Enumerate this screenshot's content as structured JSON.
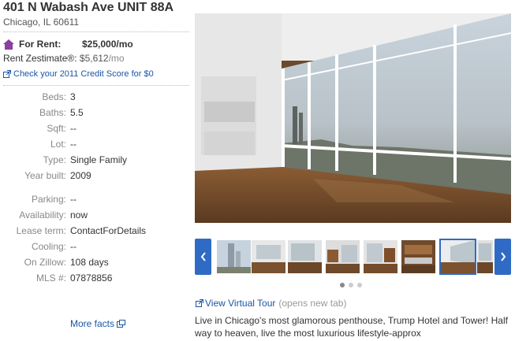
{
  "listing": {
    "address": "401 N Wabash Ave UNIT 88A",
    "city_state_zip": "Chicago, IL 60611"
  },
  "rent": {
    "label": "For Rent:",
    "price": "$25,000/mo",
    "zestimate_label": "Rent Zestimate®:",
    "zestimate_value": "$5,612",
    "zestimate_suffix": "/mo",
    "credit_link": "Check your 2011 Credit Score for $0"
  },
  "facts": [
    {
      "key": "Beds:",
      "value": "3"
    },
    {
      "key": "Baths:",
      "value": "5.5"
    },
    {
      "key": "Sqft:",
      "value": "--"
    },
    {
      "key": "Lot:",
      "value": "--"
    },
    {
      "key": "Type:",
      "value": "Single Family"
    },
    {
      "key": "Year built:",
      "value": "2009"
    },
    {
      "key": "Parking:",
      "value": "--"
    },
    {
      "key": "Availability:",
      "value": "now"
    },
    {
      "key": "Lease term:",
      "value": "ContactForDetails"
    },
    {
      "key": "Cooling:",
      "value": "--"
    },
    {
      "key": "On Zillow:",
      "value": "108 days"
    },
    {
      "key": "MLS #:",
      "value": "07878856"
    }
  ],
  "more_facts_label": "More facts",
  "virtual_tour": {
    "link": "View Virtual Tour",
    "note": "(opens new tab)"
  },
  "description": "Live in Chicago's most glamorous penthouse, Trump Hotel and Tower! Half way to heaven, live the most luxurious lifestyle-approx",
  "carousel": {
    "prev_icon": "chevron-left-icon",
    "next_icon": "chevron-right-icon",
    "thumbnail_count": 7,
    "selected_thumbnail": 6,
    "page_dots": 3,
    "active_dot": 0
  },
  "colors": {
    "link": "#1a55a5",
    "accent_button": "#2f6bc4",
    "rent_icon": "#8b3fa0"
  }
}
